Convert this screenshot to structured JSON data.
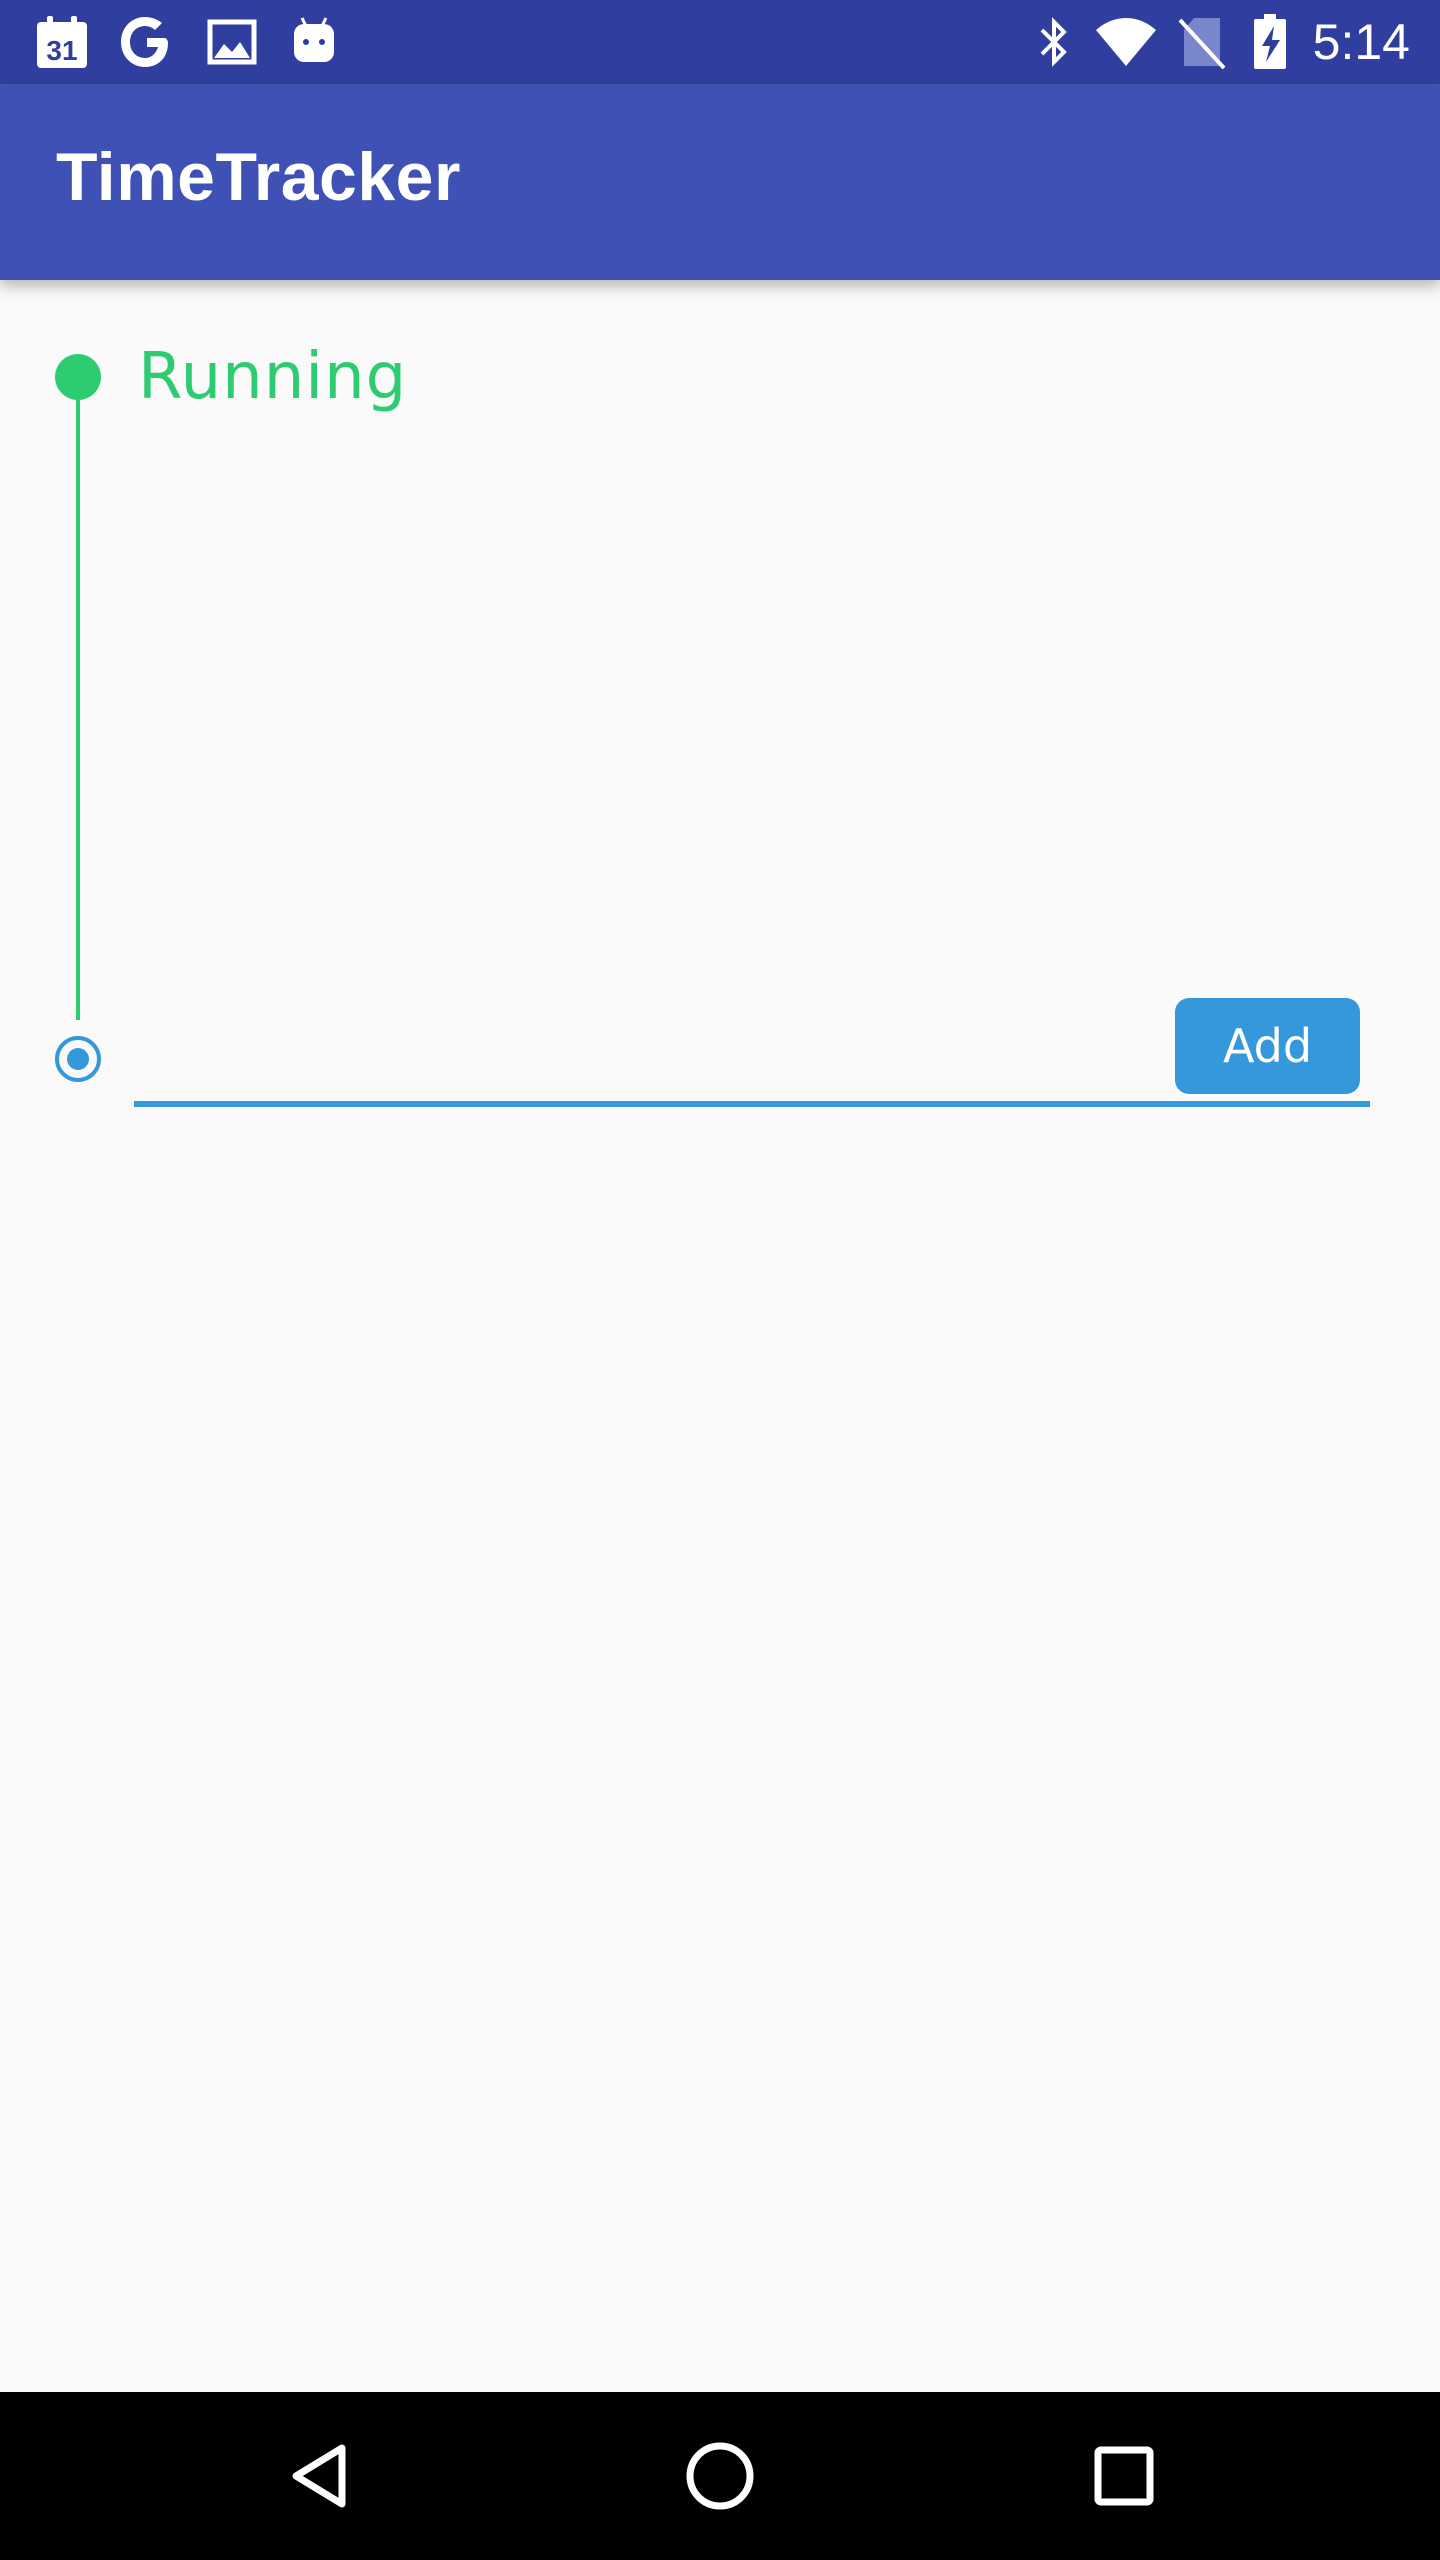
{
  "status_bar": {
    "time": "5:14",
    "left_icons": [
      "calendar-icon",
      "google-icon",
      "image-icon",
      "android-icon"
    ],
    "calendar_day": "31",
    "right_icons": [
      "bluetooth-icon",
      "wifi-icon",
      "no-sim-icon",
      "battery-charging-icon"
    ]
  },
  "app_bar": {
    "title": "TimeTracker"
  },
  "timeline": {
    "status_label": "Running",
    "status_color": "#2ecc71"
  },
  "task_entry": {
    "value": "",
    "placeholder": "",
    "add_label": "Add",
    "accent_color": "#3498db"
  },
  "nav_bar": {
    "buttons": [
      "back-icon",
      "home-icon",
      "recents-icon"
    ]
  },
  "colors": {
    "status_bar": "#303f9f",
    "app_bar": "#3f51b5",
    "background": "#fafafa"
  }
}
